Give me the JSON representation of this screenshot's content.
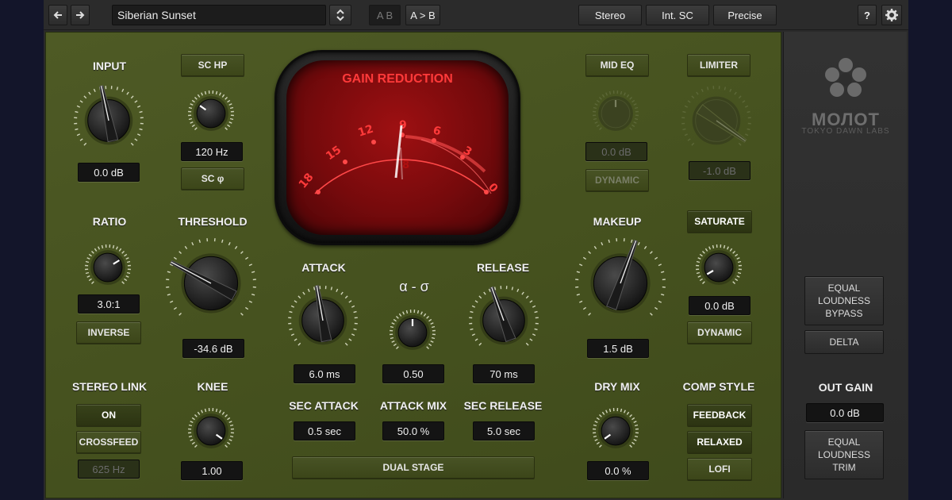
{
  "toolbar": {
    "back_icon": "arrow-left-icon",
    "forward_icon": "arrow-right-icon",
    "preset_name": "Siberian Sunset",
    "ab_label": "A B",
    "a_to_b_label": "A > B",
    "stereo_label": "Stereo",
    "int_sc_label": "Int. SC",
    "precise_label": "Precise",
    "help_label": "?",
    "settings_icon": "gear-icon"
  },
  "input": {
    "label": "INPUT",
    "value": "0.0 dB"
  },
  "sc_hp": {
    "button": "SC HP",
    "value": "120 Hz",
    "phase_button": "SC φ"
  },
  "meter": {
    "title": "GAIN REDUCTION",
    "scale": [
      "18",
      "15",
      "12",
      "9",
      "6",
      "3",
      "0"
    ]
  },
  "mid_eq": {
    "button": "MID EQ",
    "value": "0.0 dB",
    "dynamic_button": "DYNAMIC"
  },
  "limiter": {
    "button": "LIMITER",
    "value": "-1.0 dB"
  },
  "ratio": {
    "label": "RATIO",
    "value": "3.0:1",
    "inverse_button": "INVERSE"
  },
  "threshold": {
    "label": "THRESHOLD",
    "value": "-34.6 dB"
  },
  "attack": {
    "label": "ATTACK",
    "value": "6.0 ms"
  },
  "alpha_sigma": {
    "label": "α - σ",
    "value": "0.50"
  },
  "release": {
    "label": "RELEASE",
    "value": "70 ms"
  },
  "makeup": {
    "label": "MAKEUP",
    "value": "1.5 dB"
  },
  "saturate": {
    "button": "SATURATE",
    "value": "0.0 dB",
    "dynamic_button": "DYNAMIC"
  },
  "stereo_link": {
    "label": "STEREO LINK",
    "on_button": "ON",
    "crossfeed_button": "CROSSFEED",
    "crossfeed_value": "625 Hz"
  },
  "knee": {
    "label": "KNEE",
    "value": "1.00"
  },
  "sec_attack": {
    "label": "SEC ATTACK",
    "value": "0.5 sec"
  },
  "attack_mix": {
    "label": "ATTACK MIX",
    "value": "50.0 %"
  },
  "sec_release": {
    "label": "SEC RELEASE",
    "value": "5.0 sec"
  },
  "dual_stage": {
    "button": "DUAL STAGE"
  },
  "dry_mix": {
    "label": "DRY MIX",
    "value": "0.0 %"
  },
  "comp_style": {
    "label": "COMP STYLE",
    "options": [
      "FEEDBACK",
      "RELAXED",
      "LOFI"
    ]
  },
  "side": {
    "logo": "МОЛОТ",
    "logo_sub": "TOKYO DAWN LABS",
    "equal_loudness_bypass": [
      "EQUAL",
      "LOUDNESS",
      "BYPASS"
    ],
    "delta_button": "DELTA",
    "out_gain_label": "OUT GAIN",
    "out_gain_value": "0.0 dB",
    "equal_loudness_trim": [
      "EQUAL",
      "LOUDNESS",
      "TRIM"
    ]
  },
  "colors": {
    "panel": "#4a5621",
    "meter_red": "#8e0d0f",
    "meter_text": "#ff3a3a"
  }
}
